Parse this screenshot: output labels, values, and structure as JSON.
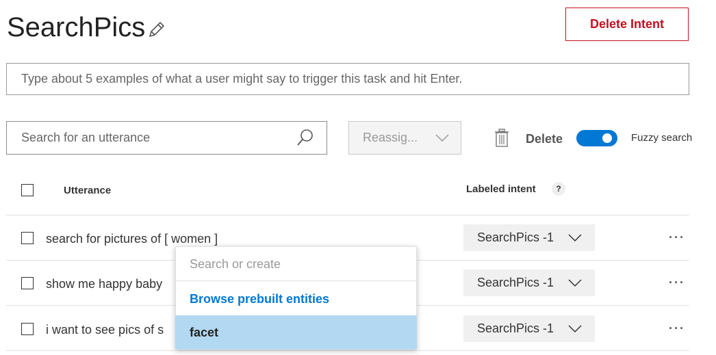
{
  "header": {
    "title": "SearchPics",
    "delete_intent_label": "Delete Intent"
  },
  "example_input": {
    "placeholder": "Type about 5 examples of what a user might say to trigger this task and hit Enter."
  },
  "toolbar": {
    "search_placeholder": "Search for an utterance",
    "reassign_label": "Reassig...",
    "delete_label": "Delete",
    "fuzzy_label": "Fuzzy search",
    "fuzzy_on": true
  },
  "table": {
    "col_utterance": "Utterance",
    "col_intent": "Labeled intent",
    "help_glyph": "?",
    "rows": [
      {
        "text": "search for pictures of [ women ]",
        "intent": "SearchPics -1"
      },
      {
        "text": "show me happy baby",
        "intent": "SearchPics -1"
      },
      {
        "text": "i want to see pics of s",
        "intent": "SearchPics -1"
      }
    ],
    "more_glyph": "···"
  },
  "entity_dropdown": {
    "search_placeholder": "Search or create",
    "browse_label": "Browse prebuilt entities",
    "items": [
      "facet"
    ]
  },
  "colors": {
    "accent": "#0078d4",
    "danger": "#c50f1f",
    "highlight": "#b3d9f2"
  }
}
